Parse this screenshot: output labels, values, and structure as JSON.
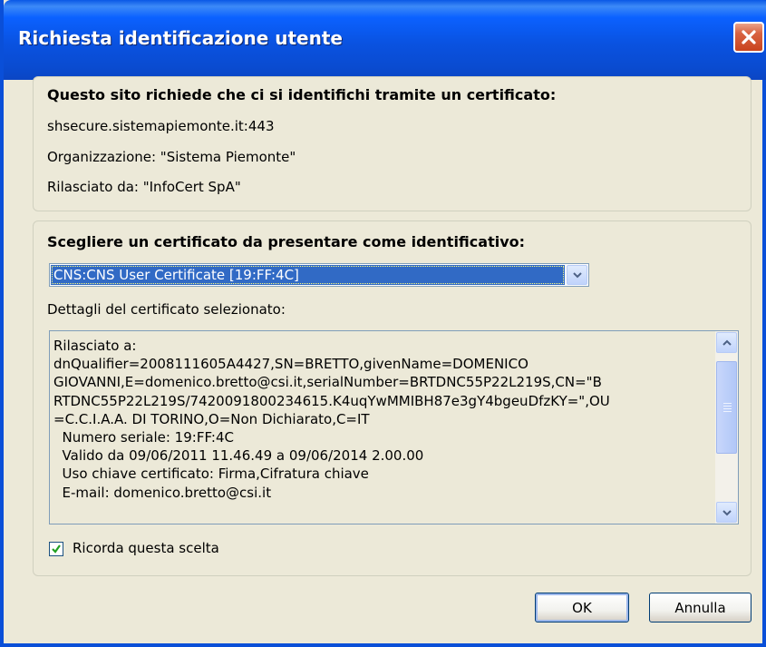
{
  "window": {
    "title": "Richiesta identificazione utente"
  },
  "site_section": {
    "heading": "Questo sito richiede che ci si identifichi tramite un certificato:",
    "host": "shsecure.sistemapiemonte.it:443",
    "organization": "Organizzazione: \"Sistema Piemonte\"",
    "issuer": "Rilasciato da: \"InfoCert SpA\""
  },
  "cert_section": {
    "heading": "Scegliere un certificato da presentare come identificativo:",
    "selected_certificate": "CNS:CNS User Certificate [19:FF:4C]",
    "details_label": "Dettagli del certificato selezionato:",
    "details_lines": [
      "Rilasciato a:",
      "dnQualifier=2008111605A4427,SN=BRETTO,givenName=DOMENICO",
      "GIOVANNI,E=domenico.bretto@csi.it,serialNumber=BRTDNC55P22L219S,CN=\"B",
      "RTDNC55P22L219S/7420091800234615.K4uqYwMMIBH87e3gY4bgeuDfzKY=\",OU",
      "=C.C.I.A.A. DI TORINO,O=Non Dichiarato,C=IT",
      "  Numero seriale: 19:FF:4C",
      "  Valido da 09/06/2011 11.46.49 a 09/06/2014 2.00.00",
      "  Uso chiave certificato: Firma,Cifratura chiave",
      "  E-mail: domenico.bretto@csi.it"
    ],
    "remember_label": "Ricorda questa scelta",
    "remember_checked": true
  },
  "buttons": {
    "ok": "OK",
    "cancel": "Annulla"
  },
  "colors": {
    "titlebar": "#0a52e0",
    "selection": "#316ac5",
    "close": "#c9431d"
  }
}
